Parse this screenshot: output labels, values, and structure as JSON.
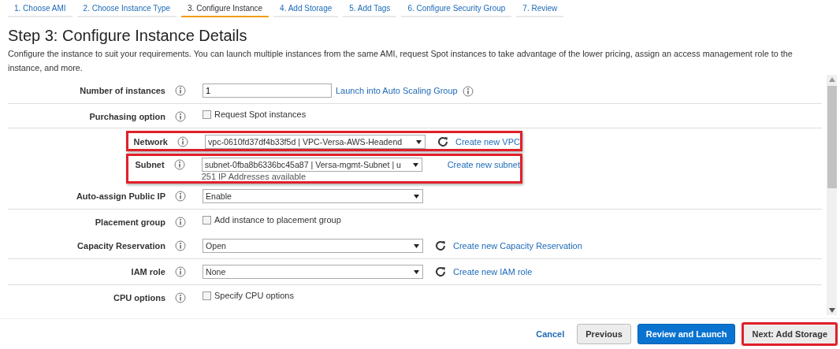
{
  "tabs": [
    {
      "label": "1. Choose AMI",
      "selected": false
    },
    {
      "label": "2. Choose Instance Type",
      "selected": false
    },
    {
      "label": "3. Configure Instance",
      "selected": true
    },
    {
      "label": "4. Add Storage",
      "selected": false
    },
    {
      "label": "5. Add Tags",
      "selected": false
    },
    {
      "label": "6. Configure Security Group",
      "selected": false
    },
    {
      "label": "7. Review",
      "selected": false
    }
  ],
  "title": "Step 3: Configure Instance Details",
  "description": "Configure the instance to suit your requirements. You can launch multiple instances from the same AMI, request Spot instances to take advantage of the lower pricing, assign an access management role to the instance, and more.",
  "rows": [
    {
      "kind": "input",
      "label": "Number of instances",
      "value": "1",
      "link": "Launch into Auto Scaling Group",
      "link_info": true,
      "highlighted": false,
      "divider": true
    },
    {
      "kind": "checkbox",
      "label": "Purchasing option",
      "option": "Request Spot instances",
      "checked": false,
      "highlighted": false,
      "divider": true
    },
    {
      "kind": "select",
      "label": "Network",
      "value": "vpc-0610fd37df4b33f5d | VPC-Versa-AWS-Headend",
      "link": "Create new VPC",
      "refresh": true,
      "highlighted": true,
      "divider": false
    },
    {
      "kind": "select",
      "label": "Subnet",
      "value": "subnet-0fba8b6336bc45a87 | Versa-mgmt-Subnet | u",
      "link": "Create new subnet",
      "refresh": false,
      "note": "251 IP Addresses available",
      "highlighted": true,
      "divider": false
    },
    {
      "kind": "select",
      "label": "Auto-assign Public IP",
      "value": "Enable",
      "refresh": false,
      "highlighted": false,
      "divider": true
    },
    {
      "kind": "checkbox",
      "label": "Placement group",
      "option": "Add instance to placement group",
      "checked": false,
      "highlighted": false,
      "divider": false
    },
    {
      "kind": "select",
      "label": "Capacity Reservation",
      "value": "Open",
      "link": "Create new Capacity Reservation",
      "refresh": true,
      "highlighted": false,
      "divider": true
    },
    {
      "kind": "select",
      "label": "IAM role",
      "value": "None",
      "link": "Create new IAM role",
      "refresh": true,
      "highlighted": false,
      "divider": true
    },
    {
      "kind": "checkbox",
      "label": "CPU options",
      "option": "Specify CPU options",
      "checked": false,
      "highlighted": false,
      "divider": false
    }
  ],
  "footer": {
    "cancel": "Cancel",
    "buttons": [
      {
        "label": "Previous",
        "kind": "secondary",
        "highlighted": false
      },
      {
        "label": "Review and Launch",
        "kind": "primary",
        "highlighted": false
      },
      {
        "label": "Next: Add Storage",
        "kind": "secondary",
        "highlighted": true
      }
    ]
  }
}
